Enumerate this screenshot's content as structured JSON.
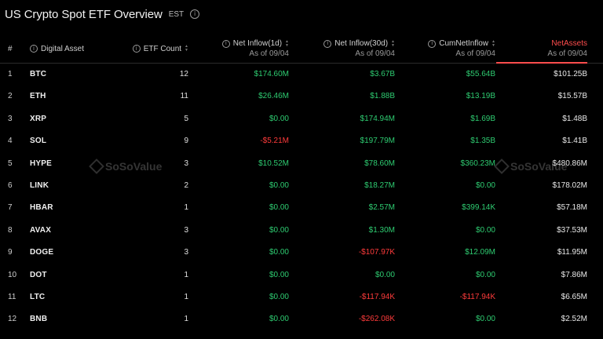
{
  "header": {
    "title": "US Crypto Spot ETF Overview",
    "timezone": "EST",
    "info_glyph": "i"
  },
  "columns": {
    "index": "#",
    "asset": "Digital Asset",
    "count": "ETF Count",
    "net1d": "Net Inflow(1d)",
    "net1d_sub": "As of 09/04",
    "net30d": "Net Inflow(30d)",
    "net30d_sub": "As of 09/04",
    "cum": "CumNetInflow",
    "cum_sub": "As of 09/04",
    "assets": "NetAssets",
    "assets_sub": "As of 09/04"
  },
  "rows": [
    {
      "idx": "1",
      "asset": "BTC",
      "count": "12",
      "n1d": "$174.60M",
      "n30d": "$3.67B",
      "cum": "$55.64B",
      "assets": "$101.25B"
    },
    {
      "idx": "2",
      "asset": "ETH",
      "count": "11",
      "n1d": "$26.46M",
      "n30d": "$1.88B",
      "cum": "$13.19B",
      "assets": "$15.57B"
    },
    {
      "idx": "3",
      "asset": "XRP",
      "count": "5",
      "n1d": "$0.00",
      "n30d": "$174.94M",
      "cum": "$1.69B",
      "assets": "$1.48B"
    },
    {
      "idx": "4",
      "asset": "SOL",
      "count": "9",
      "n1d": "-$5.21M",
      "n30d": "$197.79M",
      "cum": "$1.35B",
      "assets": "$1.41B"
    },
    {
      "idx": "5",
      "asset": "HYPE",
      "count": "3",
      "n1d": "$10.52M",
      "n30d": "$78.60M",
      "cum": "$360.23M",
      "assets": "$480.86M"
    },
    {
      "idx": "6",
      "asset": "LINK",
      "count": "2",
      "n1d": "$0.00",
      "n30d": "$18.27M",
      "cum": "$0.00",
      "assets": "$178.02M"
    },
    {
      "idx": "7",
      "asset": "HBAR",
      "count": "1",
      "n1d": "$0.00",
      "n30d": "$2.57M",
      "cum": "$399.14K",
      "assets": "$57.18M"
    },
    {
      "idx": "8",
      "asset": "AVAX",
      "count": "3",
      "n1d": "$0.00",
      "n30d": "$1.30M",
      "cum": "$0.00",
      "assets": "$37.53M"
    },
    {
      "idx": "9",
      "asset": "DOGE",
      "count": "3",
      "n1d": "$0.00",
      "n30d": "-$107.97K",
      "cum": "$12.09M",
      "assets": "$11.95M"
    },
    {
      "idx": "10",
      "asset": "DOT",
      "count": "1",
      "n1d": "$0.00",
      "n30d": "$0.00",
      "cum": "$0.00",
      "assets": "$7.86M"
    },
    {
      "idx": "11",
      "asset": "LTC",
      "count": "1",
      "n1d": "$0.00",
      "n30d": "-$117.94K",
      "cum": "-$117.94K",
      "assets": "$6.65M"
    },
    {
      "idx": "12",
      "asset": "BNB",
      "count": "1",
      "n1d": "$0.00",
      "n30d": "-$262.08K",
      "cum": "$0.00",
      "assets": "$2.52M"
    }
  ],
  "watermark": {
    "text": "SoSoValue"
  },
  "colors": {
    "positive": "#2ecc71",
    "negative": "#ff3b3b",
    "active": "#ff4d4d",
    "background": "#000000"
  },
  "icons": {
    "info": "info-circle-icon",
    "sort": "sort-arrows-icon",
    "watermark_logo": "sosovalue-logo-icon"
  }
}
